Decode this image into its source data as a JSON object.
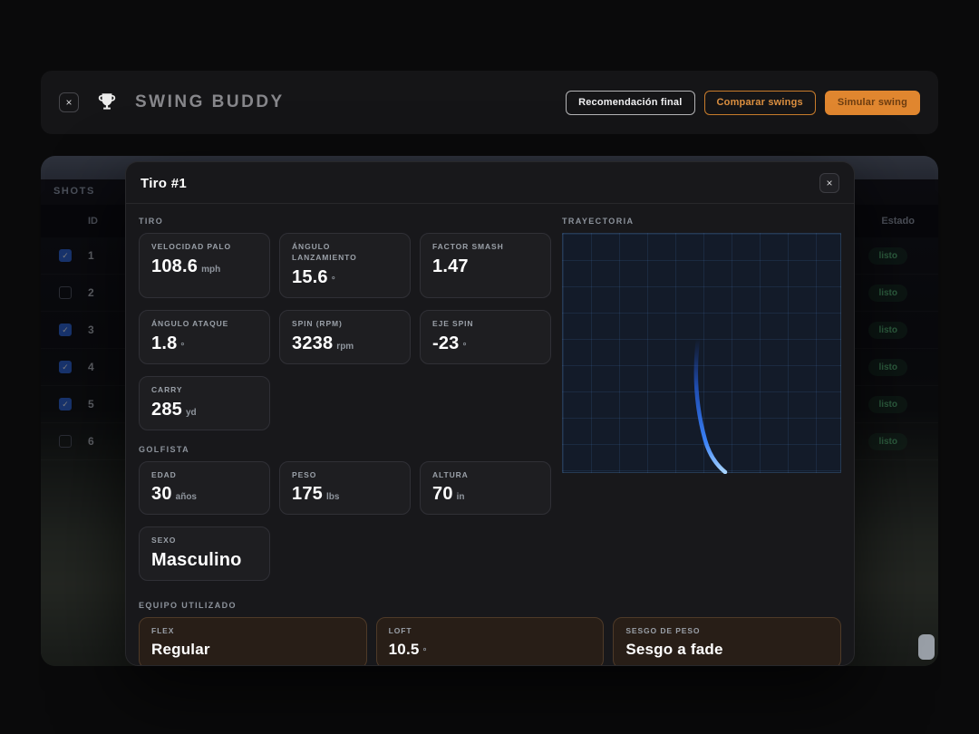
{
  "header": {
    "close_label": "×",
    "app_title": "SWING BUDDY",
    "buttons": [
      {
        "label": "Recomendación final"
      },
      {
        "label": "Comparar swings"
      },
      {
        "label": "Simular swing"
      }
    ]
  },
  "icons": {
    "close": "×",
    "check": "✓",
    "logo": "trophy-icon"
  },
  "colors": {
    "accent_orange": "#e0862f",
    "accent_blue": "#3b82f6",
    "status_green": "#5cc27d"
  },
  "shots_table": {
    "section_label": "SHOTS",
    "columns": {
      "id": "ID",
      "estado": "Estado"
    },
    "rows": [
      {
        "id": "1",
        "checked": true,
        "status": "listo"
      },
      {
        "id": "2",
        "checked": false,
        "status": "listo"
      },
      {
        "id": "3",
        "checked": true,
        "status": "listo"
      },
      {
        "id": "4",
        "checked": true,
        "status": "listo"
      },
      {
        "id": "5",
        "checked": true,
        "status": "listo"
      },
      {
        "id": "6",
        "checked": false,
        "status": "listo"
      }
    ]
  },
  "modal": {
    "title": "Tiro #1",
    "close_label": "×",
    "tiro": {
      "label": "TIRO",
      "cards": [
        {
          "label": "VELOCIDAD PALO",
          "value": "108.6",
          "unit": "mph"
        },
        {
          "label": "ÁNGULO LANZAMIENTO",
          "value": "15.6",
          "unit": "°"
        },
        {
          "label": "FACTOR SMASH",
          "value": "1.47",
          "unit": ""
        },
        {
          "label": "ÁNGULO ATAQUE",
          "value": "1.8",
          "unit": "°"
        },
        {
          "label": "SPIN (RPM)",
          "value": "3238",
          "unit": "rpm"
        },
        {
          "label": "EJE SPIN",
          "value": "-23",
          "unit": "°"
        },
        {
          "label": "CARRY",
          "value": "285",
          "unit": "yd"
        }
      ]
    },
    "golfista": {
      "label": "GOLFISTA",
      "cards": [
        {
          "label": "EDAD",
          "value": "30",
          "unit": "años"
        },
        {
          "label": "PESO",
          "value": "175",
          "unit": "lbs"
        },
        {
          "label": "ALTURA",
          "value": "70",
          "unit": "in"
        },
        {
          "label": "SEXO",
          "value": "Masculino",
          "unit": ""
        }
      ]
    },
    "equipo": {
      "label": "EQUIPO UTILIZADO",
      "cards": [
        {
          "label": "FLEX",
          "value": "Regular",
          "unit": ""
        },
        {
          "label": "LOFT",
          "value": "10.5",
          "unit": "°"
        },
        {
          "label": "SESGO DE PESO",
          "value": "Sesgo a fade",
          "unit": ""
        }
      ]
    },
    "trayectoria_label": "TRAYECTORIA"
  },
  "chart_data": {
    "type": "line",
    "title": "TRAYECTORIA",
    "description": "Top-down carry trajectory of the shot; nearly straight then curving right (fade) near the end",
    "grid": true,
    "x_range": [
      0,
      1
    ],
    "y_range": [
      0,
      1
    ],
    "series": [
      {
        "name": "trayectoria",
        "color": "#3b82f6",
        "points": [
          [
            0.48,
            0.44
          ],
          [
            0.47,
            0.6
          ],
          [
            0.48,
            0.74
          ],
          [
            0.51,
            0.86
          ],
          [
            0.55,
            0.94
          ],
          [
            0.58,
            0.99
          ]
        ]
      }
    ]
  }
}
